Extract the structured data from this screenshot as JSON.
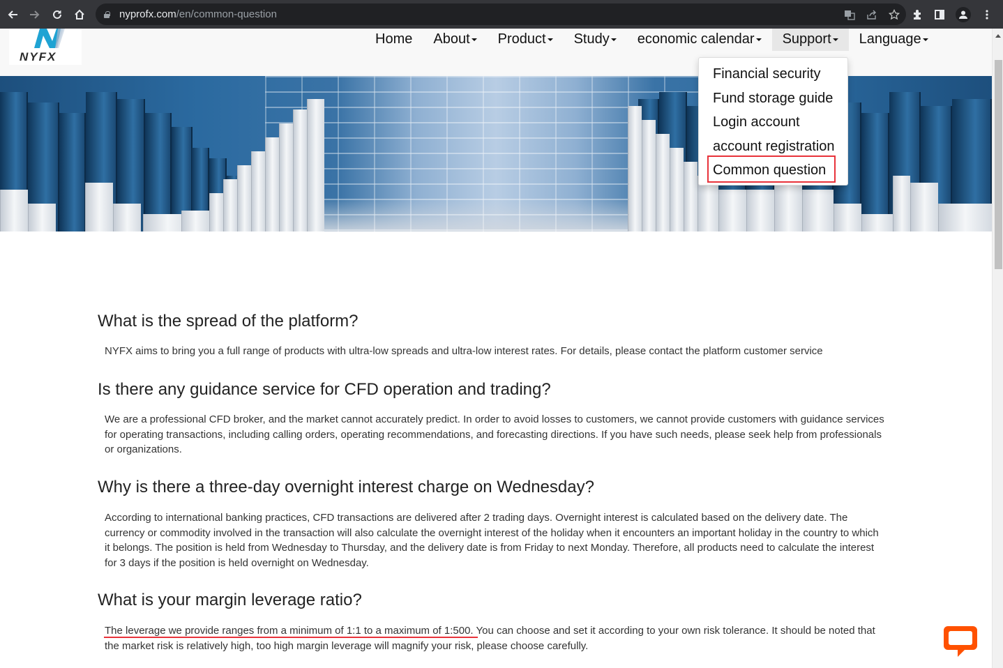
{
  "browser": {
    "url_host": "nyprofx.com",
    "url_path": "/en/common-question",
    "icons": [
      "back-icon",
      "forward-icon",
      "reload-icon",
      "home-icon",
      "lock-icon",
      "translate-icon",
      "share-icon",
      "bookmark-star-icon",
      "extensions-icon",
      "side-panel-icon",
      "profile-icon",
      "menu-dots-icon"
    ]
  },
  "site": {
    "logo_text": "NYFX",
    "nav": [
      {
        "label": "Home",
        "has_caret": false
      },
      {
        "label": "About",
        "has_caret": true
      },
      {
        "label": "Product",
        "has_caret": true
      },
      {
        "label": "Study",
        "has_caret": true
      },
      {
        "label": "economic calendar",
        "has_caret": true
      },
      {
        "label": "Support",
        "has_caret": true,
        "active": true
      },
      {
        "label": "Language",
        "has_caret": true
      }
    ],
    "support_dropdown": {
      "items": [
        "Financial security",
        "Fund storage guide",
        "Login account",
        "account registration",
        "Common question"
      ],
      "highlighted": "Common question"
    }
  },
  "faq": [
    {
      "question": "What is the spread of the platform?",
      "answer": "NYFX aims to bring you a full range of products with ultra-low spreads and ultra-low interest rates. For details, please contact the platform customer service"
    },
    {
      "question": "Is there any guidance service for CFD operation and trading?",
      "answer": "We are a professional CFD broker, and the market cannot accurately predict. In order to avoid losses to customers, we cannot provide customers with guidance services for operating transactions, including calling orders, operating recommendations, and forecasting directions. If you have such needs, please seek help from professionals or organizations."
    },
    {
      "question": "Why is there a three-day overnight interest charge on Wednesday?",
      "answer": "According to international banking practices, CFD transactions are delivered after 2 trading days. Overnight interest is calculated based on the delivery date. The currency or commodity involved in the transaction will also calculate the overnight interest of the holiday when it encounters an important holiday in the country to which it belongs. The position is held from Wednesday to Thursday, and the delivery date is from Friday to next Monday. Therefore, all products need to calculate the interest for 3 days if the position is held overnight on Wednesday."
    },
    {
      "question": "What is your margin leverage ratio?",
      "answer": "The leverage we provide ranges from a minimum of 1:1 to a maximum of 1:500. You can choose and set it according to your own risk tolerance. It should be noted that the market risk is relatively high, too high margin leverage will magnify your risk, please choose carefully."
    }
  ],
  "colors": {
    "highlight_red": "#e8323a",
    "chat_orange": "#ff5100",
    "logo_blue": "#1fa3d3"
  },
  "chat_widget": {
    "icon": "chat-bubble-icon"
  }
}
